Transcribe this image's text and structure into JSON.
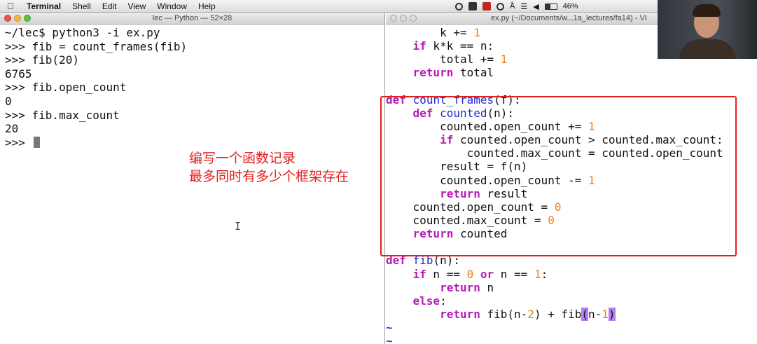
{
  "menubar": {
    "app": "Terminal",
    "items": [
      "Shell",
      "Edit",
      "View",
      "Window",
      "Help"
    ],
    "battery": "46%"
  },
  "terminal": {
    "title": "lec — Python — 52×28",
    "lines": [
      "~/lec$ python3 -i ex.py",
      ">>> fib = count_frames(fib)",
      ">>> fib(20)",
      "6765",
      ">>> fib.open_count",
      "0",
      ">>> fib.max_count",
      "20",
      ">>> "
    ]
  },
  "annotation": {
    "line1": "编写一个函数记录",
    "line2": "最多同时有多少个框架存在"
  },
  "vim": {
    "title": "ex.py (~/Documents/w...1a_lectures/fa14) - VI",
    "code": [
      [
        {
          "t": "        k += "
        },
        {
          "t": "1",
          "c": "num"
        }
      ],
      [
        {
          "t": "    "
        },
        {
          "t": "if",
          "c": "kw"
        },
        {
          "t": " k*k == n:"
        }
      ],
      [
        {
          "t": "        total += "
        },
        {
          "t": "1",
          "c": "num"
        }
      ],
      [
        {
          "t": "    "
        },
        {
          "t": "return",
          "c": "kw"
        },
        {
          "t": " total"
        }
      ],
      [],
      [
        {
          "t": "def",
          "c": "kw"
        },
        {
          "t": " "
        },
        {
          "t": "count_frames",
          "c": "fn"
        },
        {
          "t": "(f):"
        }
      ],
      [
        {
          "t": "    "
        },
        {
          "t": "def",
          "c": "kw"
        },
        {
          "t": " "
        },
        {
          "t": "counted",
          "c": "fn"
        },
        {
          "t": "(n):"
        }
      ],
      [
        {
          "t": "        counted.open_count += "
        },
        {
          "t": "1",
          "c": "num"
        }
      ],
      [
        {
          "t": "        "
        },
        {
          "t": "if",
          "c": "kw"
        },
        {
          "t": " counted.open_count > counted.max_count:"
        }
      ],
      [
        {
          "t": "            counted.max_count = counted.open_count"
        }
      ],
      [
        {
          "t": "        result = f(n)"
        }
      ],
      [
        {
          "t": "        counted.open_count -= "
        },
        {
          "t": "1",
          "c": "num"
        }
      ],
      [
        {
          "t": "        "
        },
        {
          "t": "return",
          "c": "kw"
        },
        {
          "t": " result"
        }
      ],
      [
        {
          "t": "    counted.open_count = "
        },
        {
          "t": "0",
          "c": "num"
        }
      ],
      [
        {
          "t": "    counted.max_count = "
        },
        {
          "t": "0",
          "c": "num"
        }
      ],
      [
        {
          "t": "    "
        },
        {
          "t": "return",
          "c": "kw"
        },
        {
          "t": " counted"
        }
      ],
      [],
      [
        {
          "t": "def",
          "c": "kw"
        },
        {
          "t": " "
        },
        {
          "t": "fib",
          "c": "fn"
        },
        {
          "t": "(n):"
        }
      ],
      [
        {
          "t": "    "
        },
        {
          "t": "if",
          "c": "kw"
        },
        {
          "t": " n == "
        },
        {
          "t": "0",
          "c": "num"
        },
        {
          "t": " "
        },
        {
          "t": "or",
          "c": "kw"
        },
        {
          "t": " n == "
        },
        {
          "t": "1",
          "c": "num"
        },
        {
          "t": ":"
        }
      ],
      [
        {
          "t": "        "
        },
        {
          "t": "return",
          "c": "kw"
        },
        {
          "t": " n"
        }
      ],
      [
        {
          "t": "    "
        },
        {
          "t": "else",
          "c": "kw"
        },
        {
          "t": ":"
        }
      ],
      [
        {
          "t": "        "
        },
        {
          "t": "return",
          "c": "kw"
        },
        {
          "t": " fib(n-"
        },
        {
          "t": "2",
          "c": "num"
        },
        {
          "t": ") + fib"
        },
        {
          "t": "(",
          "c": "hl"
        },
        {
          "t": "n-"
        },
        {
          "t": "1",
          "c": "num"
        },
        {
          "t": ")",
          "c": "hl"
        }
      ],
      [
        {
          "t": "~",
          "c": "tilde"
        }
      ],
      [
        {
          "t": "~",
          "c": "tilde"
        }
      ]
    ]
  }
}
